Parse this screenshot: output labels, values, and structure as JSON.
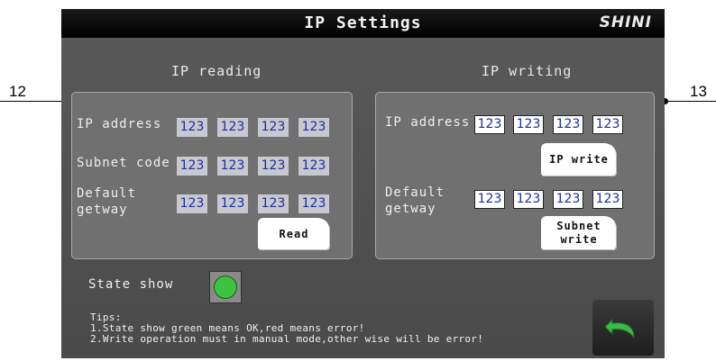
{
  "header": {
    "title": "IP Settings",
    "logo": "SHINI"
  },
  "reading": {
    "title": "IP reading",
    "ip_label": "IP address",
    "ip": [
      "123",
      "123",
      "123",
      "123"
    ],
    "subnet_label": "Subnet code",
    "subnet": [
      "123",
      "123",
      "123",
      "123"
    ],
    "gateway_label_1": "Default",
    "gateway_label_2": "getway",
    "gateway": [
      "123",
      "123",
      "123",
      "123"
    ],
    "read_button": "Read"
  },
  "writing": {
    "title": "IP writing",
    "ip_label": "IP address",
    "ip": [
      "123",
      "123",
      "123",
      "123"
    ],
    "ip_write_button": "IP write",
    "gateway_label_1": "Default",
    "gateway_label_2": "getway",
    "gateway": [
      "123",
      "123",
      "123",
      "123"
    ],
    "subnet_write_1": "Subnet",
    "subnet_write_2": "write"
  },
  "state": {
    "label": "State show",
    "status_color": "#3fc23f"
  },
  "tips": {
    "line0": "Tips:",
    "line1": "1.State show green means OK,red means error!",
    "line2": "2.Write operation must in manual mode,other wise will be error!"
  },
  "back_icon": "undo-arrow-icon",
  "callouts": {
    "left": "12",
    "right": "13"
  }
}
